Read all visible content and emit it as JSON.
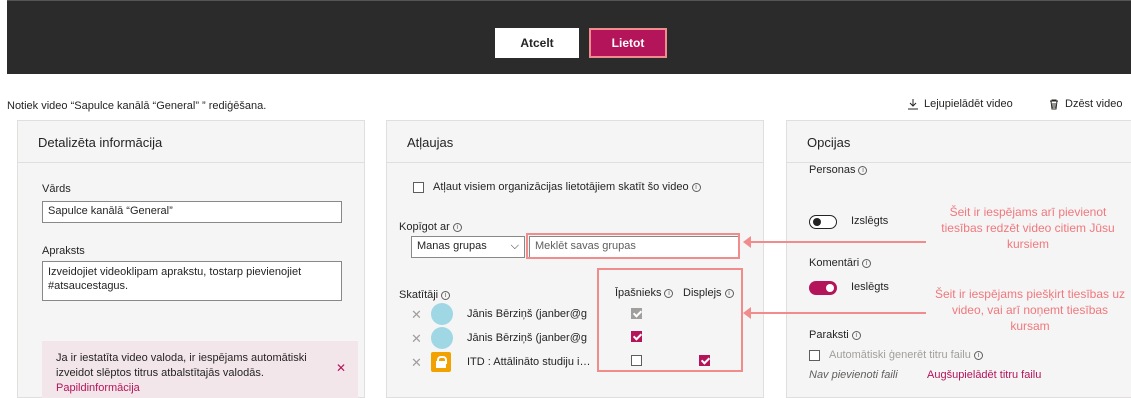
{
  "toolbar": {
    "cancel_label": "Atcelt",
    "apply_label": "Lietot"
  },
  "header": {
    "editing_text": "Notiek video “Sapulce kanālā “General” ” rediģēšana.",
    "download_label": "Lejupielādēt video",
    "delete_label": "Dzēst video"
  },
  "details": {
    "title": "Detalizēta informācija",
    "name_label": "Vārds",
    "name_value": "Sapulce kanālā “General”",
    "description_label": "Apraksts",
    "description_value": "Izveidojiet videoklipam aprakstu, tostarp pievienojiet #atsaucestagus.",
    "notice_text": "Ja ir iestatīta video valoda, ir iespējams automātiski izveidot slēptos titrus atbalstītajās valodās.",
    "notice_link": "Papildinformācija"
  },
  "permissions": {
    "title": "Atļaujas",
    "allow_all_label": "Atļaut visiem organizācijas lietotājiem skatīt šo video",
    "share_label": "Kopīgot ar",
    "share_select": "Manas grupas",
    "search_placeholder": "Meklēt savas grupas",
    "viewers_label": "Skatītāji",
    "owner_col": "Īpašnieks",
    "display_col": "Displejs",
    "viewers": [
      {
        "name": "Jānis Bērziņš (janber@g",
        "owner": "grey",
        "display": "none"
      },
      {
        "name": "Jānis Bērziņš (janber@g",
        "owner": "checked",
        "display": "none"
      },
      {
        "name": "ITD : Attālināto studiju i…",
        "owner": "unchecked",
        "display": "checked"
      }
    ]
  },
  "options": {
    "title": "Opcijas",
    "people_label": "Personas",
    "people_state": "Izslēgts",
    "comments_label": "Komentāri",
    "comments_state": "Ieslēgts",
    "captions_label": "Paraksti",
    "autogen_label": "Automātiski ģenerēt titru failu",
    "no_files": "Nav pievienoti faili",
    "upload_link": "Augšupielādēt titru failu"
  },
  "annotations": {
    "top": "Šeit ir iespējams arī pievienot tiesības redzēt video citiem Jūsu kursiem",
    "bottom": "Šeit ir iespējams piešķirt tiesības uz video, vai arī noņemt tiesības kursam"
  },
  "colors": {
    "accent": "#b4145a",
    "annotation": "#f08c8c",
    "topbar": "#2b2b2b"
  }
}
